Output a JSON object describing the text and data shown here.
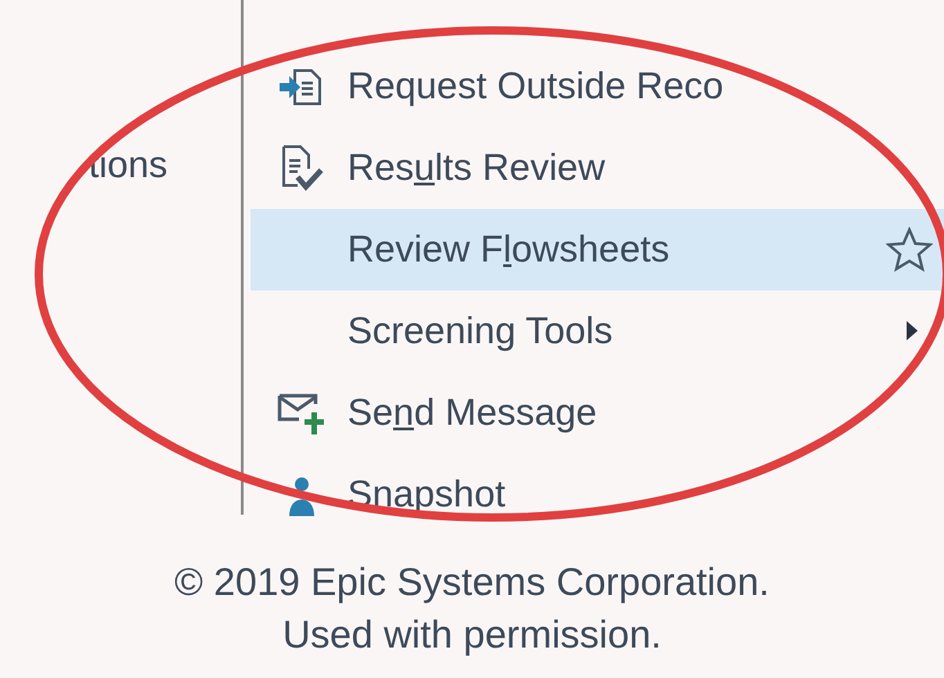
{
  "side_label": "tions",
  "menu_items": [
    {
      "parts": {
        "before": "Request Outside Reco"
      },
      "kind": "request",
      "selected": false,
      "shows_star": false,
      "has_submenu": false
    },
    {
      "parts": {
        "before": "Res",
        "key": "u",
        "after": "lts Review"
      },
      "kind": "results",
      "selected": false,
      "shows_star": false,
      "has_submenu": false
    },
    {
      "parts": {
        "before": "Review F",
        "key": "l",
        "after": "owsheets"
      },
      "kind": "plain",
      "selected": true,
      "shows_star": true,
      "has_submenu": false
    },
    {
      "parts": {
        "before": "Screening Tools"
      },
      "kind": "plain",
      "selected": false,
      "shows_star": false,
      "has_submenu": true
    },
    {
      "parts": {
        "before": "Se",
        "key": "n",
        "after": "d Message"
      },
      "kind": "message",
      "selected": false,
      "shows_star": false,
      "has_submenu": false
    },
    {
      "parts": {
        "before": "Snapshot"
      },
      "kind": "snapshot",
      "selected": false,
      "shows_star": false,
      "has_submenu": false
    }
  ],
  "footer": [
    "© 2019 Epic Systems Corporation.",
    "Used with permission."
  ]
}
